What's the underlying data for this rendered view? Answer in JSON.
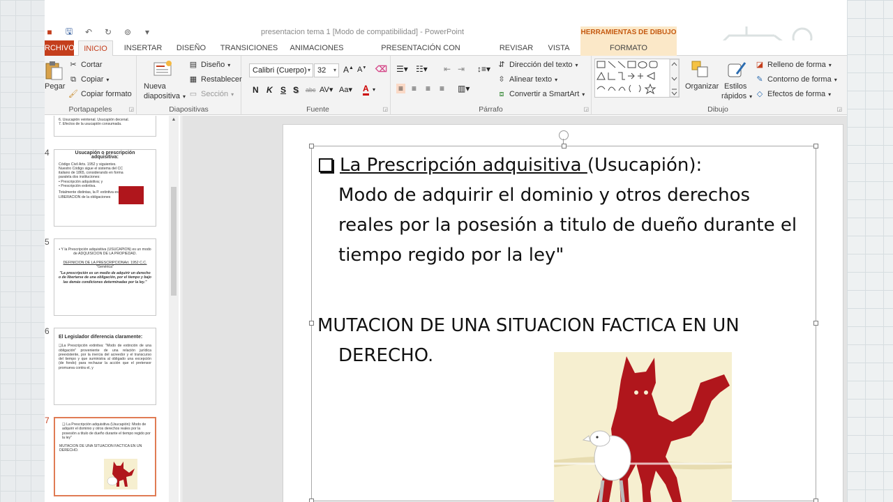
{
  "window": {
    "title": "presentacion tema 1 [Modo de compatibilidad] - PowerPoint",
    "context_header": "HERRAMIENTAS DE DIBUJO"
  },
  "tabs": [
    {
      "label": "RCHIVO"
    },
    {
      "label": "INICIO"
    },
    {
      "label": "INSERTAR"
    },
    {
      "label": "DISEÑO"
    },
    {
      "label": "TRANSICIONES"
    },
    {
      "label": "ANIMACIONES"
    },
    {
      "label": "PRESENTACIÓN CON DIAPOSITIVAS"
    },
    {
      "label": "REVISAR"
    },
    {
      "label": "VISTA"
    },
    {
      "label": "FORMATO"
    }
  ],
  "ribbon": {
    "clipboard": {
      "label": "Portapapeles",
      "paste": "Pegar",
      "cut": "Cortar",
      "copy": "Copiar",
      "format_painter": "Copiar formato"
    },
    "slides": {
      "label": "Diapositivas",
      "new_slide_1": "Nueva",
      "new_slide_2": "diapositiva",
      "layout": "Diseño",
      "reset": "Restablecer",
      "section": "Sección"
    },
    "font": {
      "label": "Fuente",
      "font_name": "Calibri (Cuerpo)",
      "font_size": "32"
    },
    "paragraph": {
      "label": "Párrafo",
      "text_direction": "Dirección del texto",
      "align_text": "Alinear texto",
      "smartart": "Convertir a SmartArt"
    },
    "drawing": {
      "label": "Dibujo",
      "arrange": "Organizar",
      "quick_styles_1": "Estilos",
      "quick_styles_2": "rápidos",
      "shape_fill": "Relleno de forma",
      "shape_outline": "Contorno de forma",
      "shape_effects": "Efectos de forma"
    }
  },
  "thumbnails": [
    {
      "number": "",
      "lines": [
        "6.  Usucapión veintenal.  Usucapión decenal.",
        "7.  Efectos de la usucapión consumada."
      ]
    },
    {
      "number": "4",
      "title": "Usucapión o prescripción adquisitiva:",
      "lines": [
        "Código Civil Arts. 1952 y siguientes.",
        "Nuestro Código sigue el sistema del CC italiano de 1865, considerando en forma paralela dos instituciones:",
        "•  Prescripción adquisitiva; y",
        "•  Prescripción extintiva.",
        "Totalmente distintas, la P. extintiva es una formula de LIBERACION de la obligaciones"
      ]
    },
    {
      "number": "5",
      "lines": [
        "•  Y la Prescripción adquisitiva (USUCAPION) es un modo de ADQUISICION DE LA PROPIEDAD.",
        "DEFINICION DE LA PRESCRIPCIONArt. 1952 C.C.",
        "\"Genérica\"",
        "\"La prescripción es un medio de adquirir un derecho o de libertarse de una obligación, por el tiempo y bajo las demás condiciones determinadas por la ley.\""
      ]
    },
    {
      "number": "6",
      "title": "El Legislador diferencia claramente:",
      "lines": [
        "❑La Prescripción extintiva: \"Modo de extinción de una obligación\" proveniente de una relación jurídica preexistente, por la inercia del acreedor y el transcurso del tiempo y que suministra al obligado una excepción (de fondo) para rechazar la acción que el pretensor promueva contra el, y"
      ]
    },
    {
      "number": "7",
      "lines": [
        "❑ La Prescripción adquisitiva (Usucapión): Modo de adquirir el dominio y otros derechos reales por la posesión a titulo de dueño durante el tiempo regido por la ley\"",
        "MUTACION DE UNA SITUACION FACTICA EN UN DERECHO."
      ]
    }
  ],
  "slide": {
    "p1_underlined": "La Prescripción adquisitiva ",
    "p1_paren": "(Usucapión):",
    "p1_rest": "Modo de adquirir el dominio y otros derechos reales por la posesión a titulo de dueño durante el tiempo regido por la ley\"",
    "p2_line1": "MUTACION DE UNA SITUACION FACTICA EN UN",
    "p2_line2": "DERECHO."
  },
  "colors": {
    "accent": "#c43e1c",
    "context": "#fbe8c8",
    "ribbon_bg": "#f3f3f3",
    "wolf": "#b0161c"
  }
}
